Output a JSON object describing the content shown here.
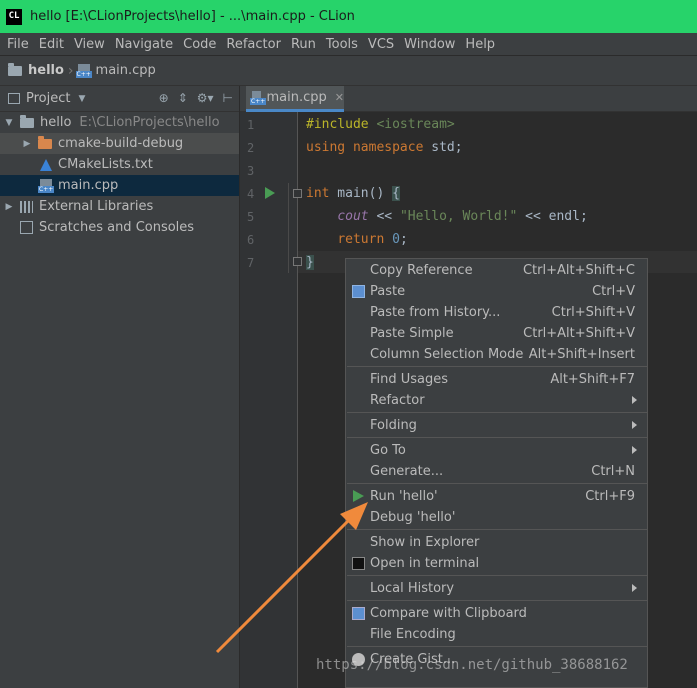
{
  "window": {
    "title": "hello [E:\\CLionProjects\\hello] - ...\\main.cpp - CLion",
    "app_icon_label": "CL"
  },
  "menu": [
    "File",
    "Edit",
    "View",
    "Navigate",
    "Code",
    "Refactor",
    "Run",
    "Tools",
    "VCS",
    "Window",
    "Help"
  ],
  "breadcrumb": {
    "project": "hello",
    "file": "main.cpp"
  },
  "project_panel": {
    "title": "Project",
    "tree": {
      "root_name": "hello",
      "root_path": "E:\\CLionProjects\\hello",
      "items": [
        "cmake-build-debug",
        "CMakeLists.txt",
        "main.cpp"
      ],
      "external": "External Libraries",
      "scratches": "Scratches and Consoles"
    }
  },
  "editor": {
    "tab": "main.cpp",
    "line_numbers": [
      "1",
      "2",
      "3",
      "4",
      "5",
      "6",
      "7"
    ],
    "code": {
      "l1_kw": "#include",
      "l1_rest": " <iostream>",
      "l2_kw1": "using",
      "l2_kw2": "namespace",
      "l2_rest": " std;",
      "l4_kw": "int",
      "l4_rest": " main() ",
      "l4_brace": "{",
      "l5_cout": "cout",
      "l5_op1": " << ",
      "l5_str": "\"Hello, World!\"",
      "l5_op2": " << endl;",
      "l6_kw": "return",
      "l6_num": "0",
      "l6_semi": ";",
      "l7": "}"
    }
  },
  "context_menu": {
    "items": [
      {
        "label": "Copy Reference",
        "shortcut": "Ctrl+Alt+Shift+C"
      },
      {
        "label": "Paste",
        "shortcut": "Ctrl+V"
      },
      {
        "label": "Paste from History...",
        "shortcut": "Ctrl+Shift+V"
      },
      {
        "label": "Paste Simple",
        "shortcut": "Ctrl+Alt+Shift+V"
      },
      {
        "label": "Column Selection Mode",
        "shortcut": "Alt+Shift+Insert"
      },
      {
        "label": "Find Usages",
        "shortcut": "Alt+Shift+F7"
      },
      {
        "label": "Refactor",
        "shortcut": ""
      },
      {
        "label": "Folding",
        "shortcut": ""
      },
      {
        "label": "Go To",
        "shortcut": ""
      },
      {
        "label": "Generate...",
        "shortcut": "Ctrl+N"
      },
      {
        "label": "Run 'hello'",
        "shortcut": "Ctrl+F9"
      },
      {
        "label": "Debug 'hello'",
        "shortcut": ""
      },
      {
        "label": "Show in Explorer",
        "shortcut": ""
      },
      {
        "label": "Open in terminal",
        "shortcut": ""
      },
      {
        "label": "Local History",
        "shortcut": ""
      },
      {
        "label": "Compare with Clipboard",
        "shortcut": ""
      },
      {
        "label": "File Encoding",
        "shortcut": ""
      },
      {
        "label": "Create Gist...",
        "shortcut": ""
      }
    ]
  },
  "watermark": "https://blog.csdn.net/github_38688162",
  "colors": {
    "title_bar": "#27d36a",
    "annotation_arrow": "#f08a3c",
    "run": "#499c54"
  }
}
